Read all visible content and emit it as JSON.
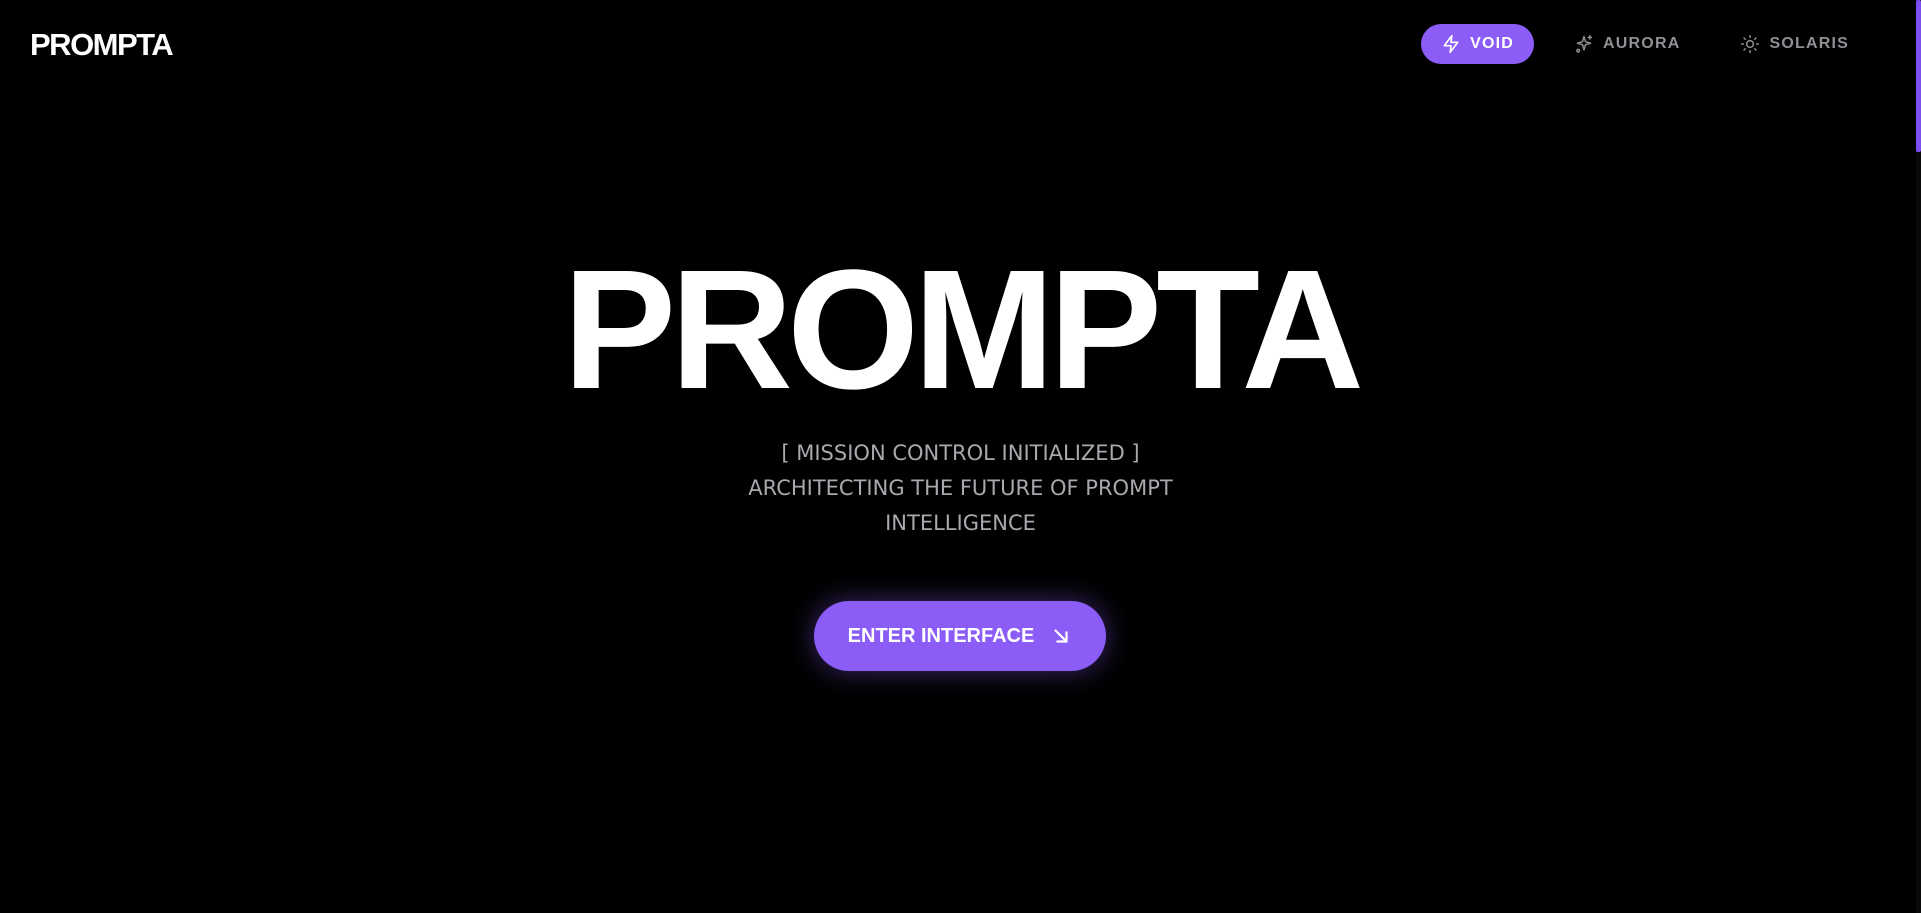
{
  "header": {
    "logo": "PROMPTA",
    "themes": [
      {
        "label": "VOID",
        "icon": "lightning-icon",
        "active": true
      },
      {
        "label": "AURORA",
        "icon": "sparkles-icon",
        "active": false
      },
      {
        "label": "SOLARIS",
        "icon": "sun-icon",
        "active": false
      }
    ]
  },
  "hero": {
    "title": "PROMPTA",
    "subtitle_lines": [
      "[ MISSION CONTROL INITIALIZED ]",
      "ARCHITECTING THE FUTURE OF PROMPT",
      "INTELLIGENCE"
    ],
    "cta_label": "ENTER INTERFACE",
    "cta_icon": "arrow-down-right-icon"
  },
  "colors": {
    "background": "#000000",
    "accent": "#8b5cf6",
    "muted_text": "#a8a8ae"
  }
}
